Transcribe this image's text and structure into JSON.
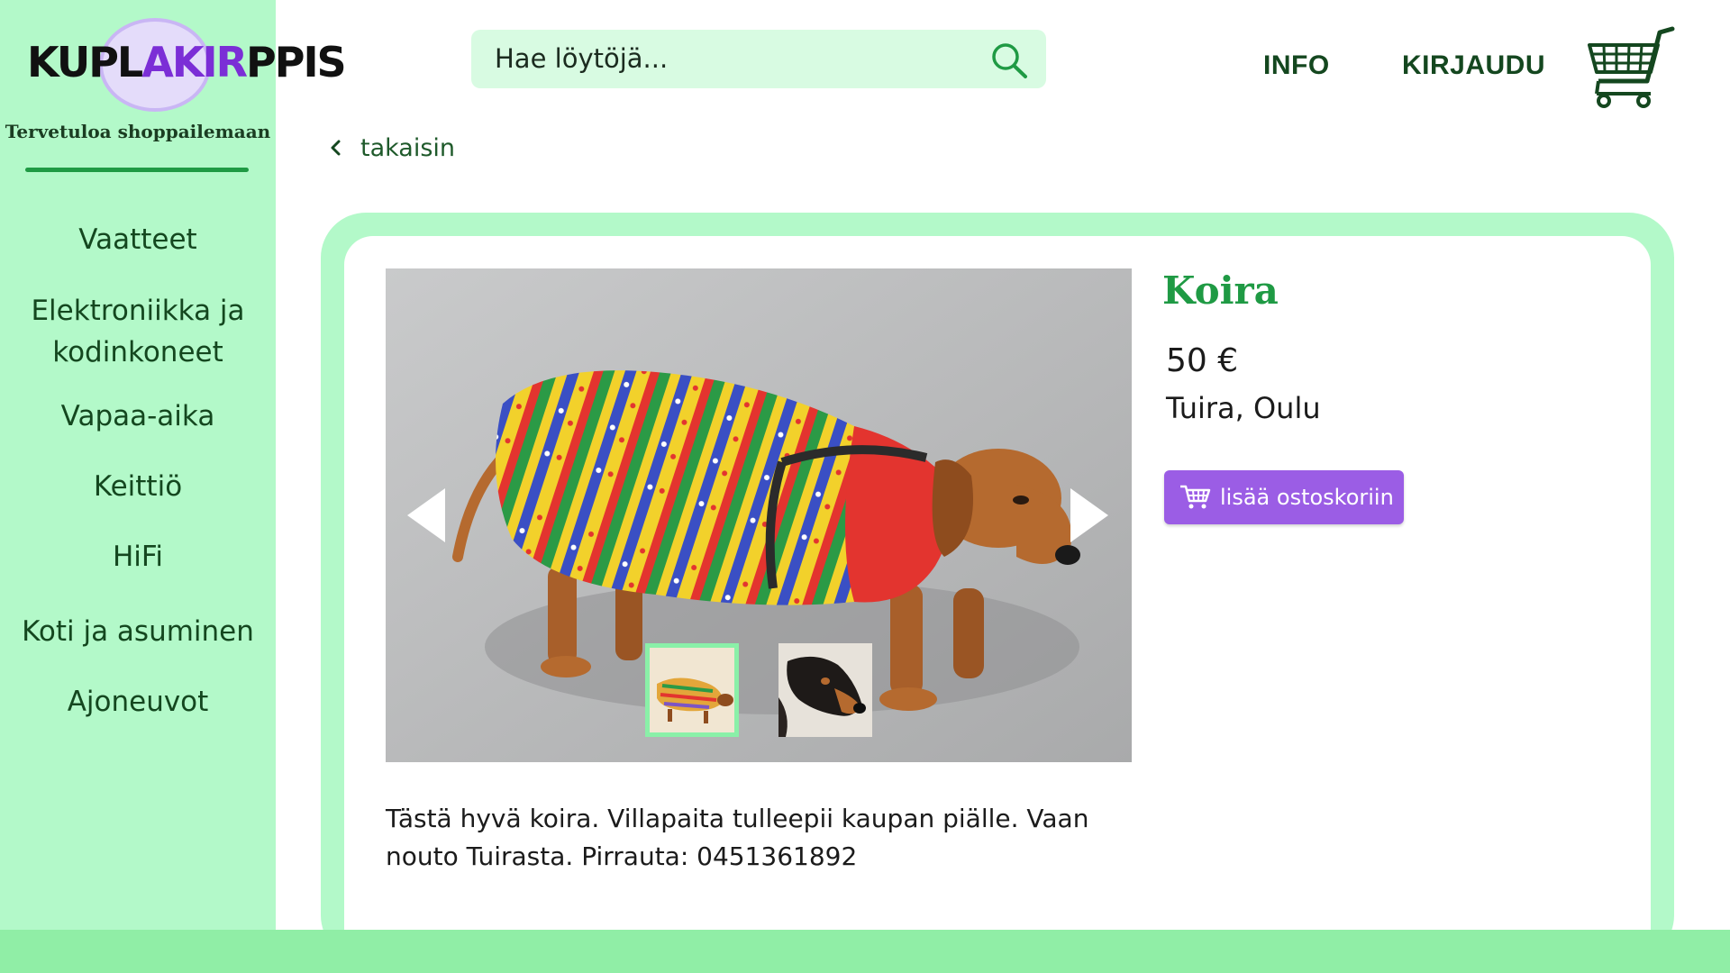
{
  "brand": {
    "logo_text": "KUPLAKIRPPIS",
    "tagline": "Tervetuloa shoppailemaan"
  },
  "sidebar": {
    "categories": [
      {
        "label": "Vaatteet"
      },
      {
        "label": "Elektroniikka ja kodinkoneet"
      },
      {
        "label": "Vapaa-aika"
      },
      {
        "label": "Keittiö"
      },
      {
        "label": "HiFi"
      },
      {
        "label": "Koti ja asuminen"
      },
      {
        "label": "Ajoneuvot"
      }
    ]
  },
  "header": {
    "search_placeholder": "Hae löytöjä...",
    "search_icon": "search-icon",
    "nav": [
      {
        "label": "INFO"
      },
      {
        "label": "KIRJAUDU"
      }
    ],
    "cart_icon": "shopping-cart-icon"
  },
  "back_link": {
    "label": "takaisin",
    "icon": "chevron-left-icon"
  },
  "product": {
    "title": "Koira",
    "price": "50 €",
    "location": "Tuira, Oulu",
    "add_to_cart_label": "lisää ostoskoriin",
    "description": "Tästä hyvä koira. Villapaita tulleepii kaupan piälle. Vaan nouto Tuirasta. Pirrauta: 0451361892",
    "gallery": {
      "image_count": 2,
      "selected_index": 0,
      "prev_icon": "arrow-left-icon",
      "next_icon": "arrow-right-icon"
    }
  },
  "colors": {
    "sidebar_bg": "#b3f9c9",
    "accent_green": "#1f9a44",
    "dark_green": "#14471f",
    "button_purple": "#9b5de5",
    "footer_green": "#90eea6",
    "search_bg": "#d8fbe2"
  }
}
